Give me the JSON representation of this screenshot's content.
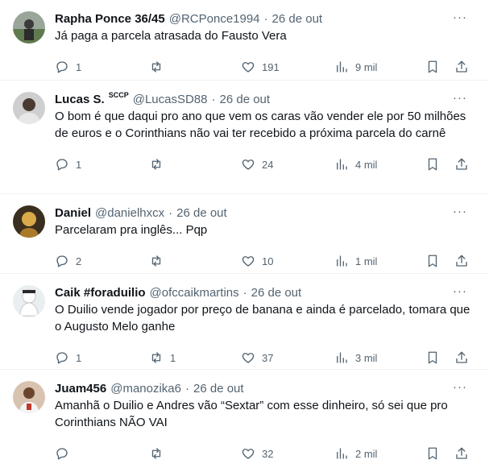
{
  "tweets": [
    {
      "name": "Rapha Ponce 36/45",
      "badge": "",
      "handle": "@RCPonce1994",
      "date": "26 de out",
      "text": "Já paga a parcela atrasada do Fausto Vera",
      "replies": "1",
      "retweets": "",
      "likes": "191",
      "views": "9 mil"
    },
    {
      "name": "Lucas S.",
      "badge": "SCCP",
      "handle": "@LucasSD88",
      "date": "26 de out",
      "text": "O bom é que daqui pro ano que vem os caras vão vender ele por 50 milhões de euros e o Corinthians não vai ter recebido a próxima parcela do carnê",
      "replies": "1",
      "retweets": "",
      "likes": "24",
      "views": "4 mil"
    },
    {
      "name": "Daniel",
      "badge": "",
      "handle": "@danielhxcx",
      "date": "26 de out",
      "text": "Parcelaram pra inglês... Pqp",
      "replies": "2",
      "retweets": "",
      "likes": "10",
      "views": "1 mil"
    },
    {
      "name": "Caik #foraduilio",
      "badge": "",
      "handle": "@ofccaikmartins",
      "date": "26 de out",
      "text": "O Duilio vende jogador por preço de banana e ainda é parcelado, tomara que o Augusto Melo ganhe",
      "replies": "1",
      "retweets": "1",
      "likes": "37",
      "views": "3 mil"
    },
    {
      "name": "Juam456",
      "badge": "",
      "handle": "@manozika6",
      "date": "26 de out",
      "text": "Amanhã o Duilio e Andres vão “Sextar” com esse dinheiro, só sei que pro Corinthians NÃO VAI",
      "replies": "",
      "retweets": "",
      "likes": "32",
      "views": "2 mil"
    }
  ],
  "separator": "·",
  "more_glyph": "···",
  "colors": {
    "text_primary": "#0f1419",
    "text_secondary": "#536471",
    "divider": "#eff3f4"
  }
}
